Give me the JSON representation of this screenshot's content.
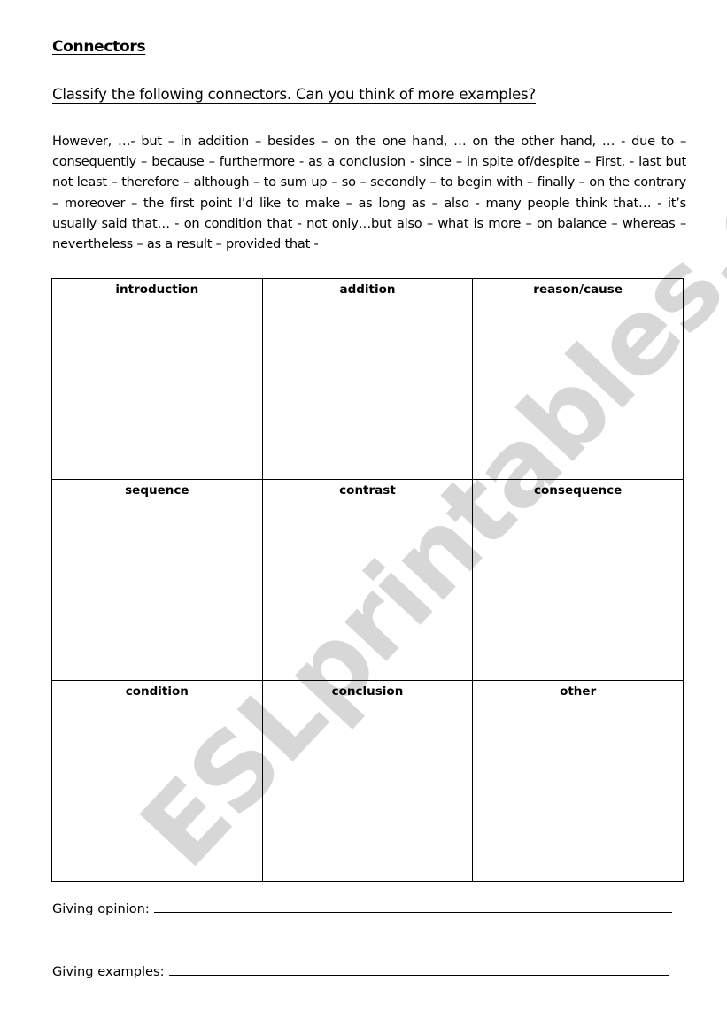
{
  "worksheet": {
    "title": "Connectors",
    "instruction": "Classify the following connectors. Can you think of more examples?",
    "word_bank": "However, …- but –  in addition – besides – on the one hand, … on the other hand, … - due to – consequently – because – furthermore - as a conclusion - since – in spite of/despite – First, - last but not least – therefore – although – to sum up – so – secondly – to begin with – finally – on the contrary – moreover – the first point I’d like to make – as long as – also - many people think that… - it’s usually said that… - on condition that - not only…but also – what is more – on balance – whereas – nevertheless – as a result – provided that -",
    "categories": [
      [
        "introduction",
        "addition",
        "reason/cause"
      ],
      [
        "sequence",
        "contrast",
        "consequence"
      ],
      [
        "condition",
        "conclusion",
        "other"
      ]
    ],
    "fill_lines": [
      {
        "label": "Giving opinion:",
        "value": ""
      },
      {
        "label": "Giving examples:",
        "value": ""
      }
    ]
  },
  "watermark": "ESLprintables.com"
}
